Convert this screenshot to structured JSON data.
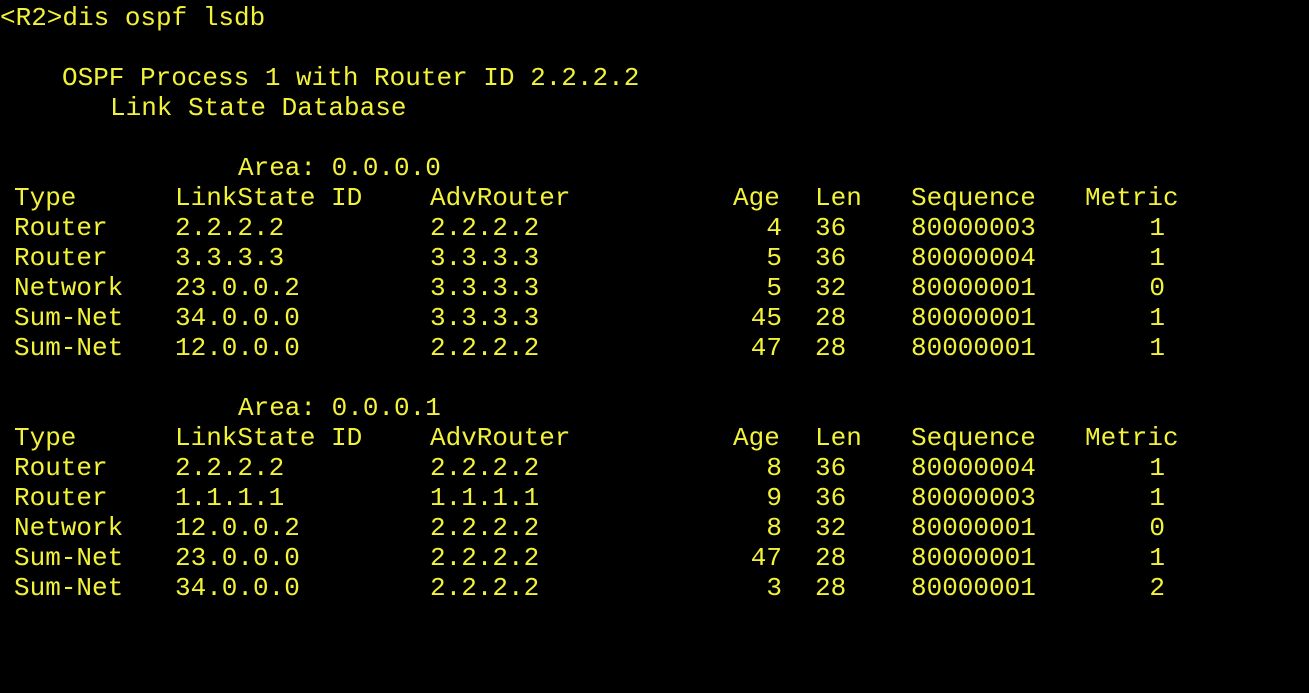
{
  "terminal": {
    "prompt": "<R2>dis ospf lsdb",
    "process_line": "OSPF Process 1 with Router ID 2.2.2.2",
    "db_title": "Link State Database",
    "colors": {
      "background": "#000000",
      "text": "#f2f23a"
    }
  },
  "headers": {
    "type": "Type",
    "lsid": "LinkState ID",
    "adv": "AdvRouter",
    "age": "Age",
    "len": "Len",
    "seq": "Sequence",
    "metric": "Metric"
  },
  "areas": [
    {
      "label": "Area: 0.0.0.0",
      "rows": [
        {
          "type": "Router",
          "lsid": "2.2.2.2",
          "adv": "2.2.2.2",
          "age": "4",
          "len": "36",
          "seq": "80000003",
          "metric": "1"
        },
        {
          "type": "Router",
          "lsid": "3.3.3.3",
          "adv": "3.3.3.3",
          "age": "5",
          "len": "36",
          "seq": "80000004",
          "metric": "1"
        },
        {
          "type": "Network",
          "lsid": "23.0.0.2",
          "adv": "3.3.3.3",
          "age": "5",
          "len": "32",
          "seq": "80000001",
          "metric": "0"
        },
        {
          "type": "Sum-Net",
          "lsid": "34.0.0.0",
          "adv": "3.3.3.3",
          "age": "45",
          "len": "28",
          "seq": "80000001",
          "metric": "1"
        },
        {
          "type": "Sum-Net",
          "lsid": "12.0.0.0",
          "adv": "2.2.2.2",
          "age": "47",
          "len": "28",
          "seq": "80000001",
          "metric": "1"
        }
      ]
    },
    {
      "label": "Area: 0.0.0.1",
      "rows": [
        {
          "type": "Router",
          "lsid": "2.2.2.2",
          "adv": "2.2.2.2",
          "age": "8",
          "len": "36",
          "seq": "80000004",
          "metric": "1"
        },
        {
          "type": "Router",
          "lsid": "1.1.1.1",
          "adv": "1.1.1.1",
          "age": "9",
          "len": "36",
          "seq": "80000003",
          "metric": "1"
        },
        {
          "type": "Network",
          "lsid": "12.0.0.2",
          "adv": "2.2.2.2",
          "age": "8",
          "len": "32",
          "seq": "80000001",
          "metric": "0"
        },
        {
          "type": "Sum-Net",
          "lsid": "23.0.0.0",
          "adv": "2.2.2.2",
          "age": "47",
          "len": "28",
          "seq": "80000001",
          "metric": "1"
        },
        {
          "type": "Sum-Net",
          "lsid": "34.0.0.0",
          "adv": "2.2.2.2",
          "age": "3",
          "len": "28",
          "seq": "80000001",
          "metric": "2"
        }
      ]
    }
  ]
}
